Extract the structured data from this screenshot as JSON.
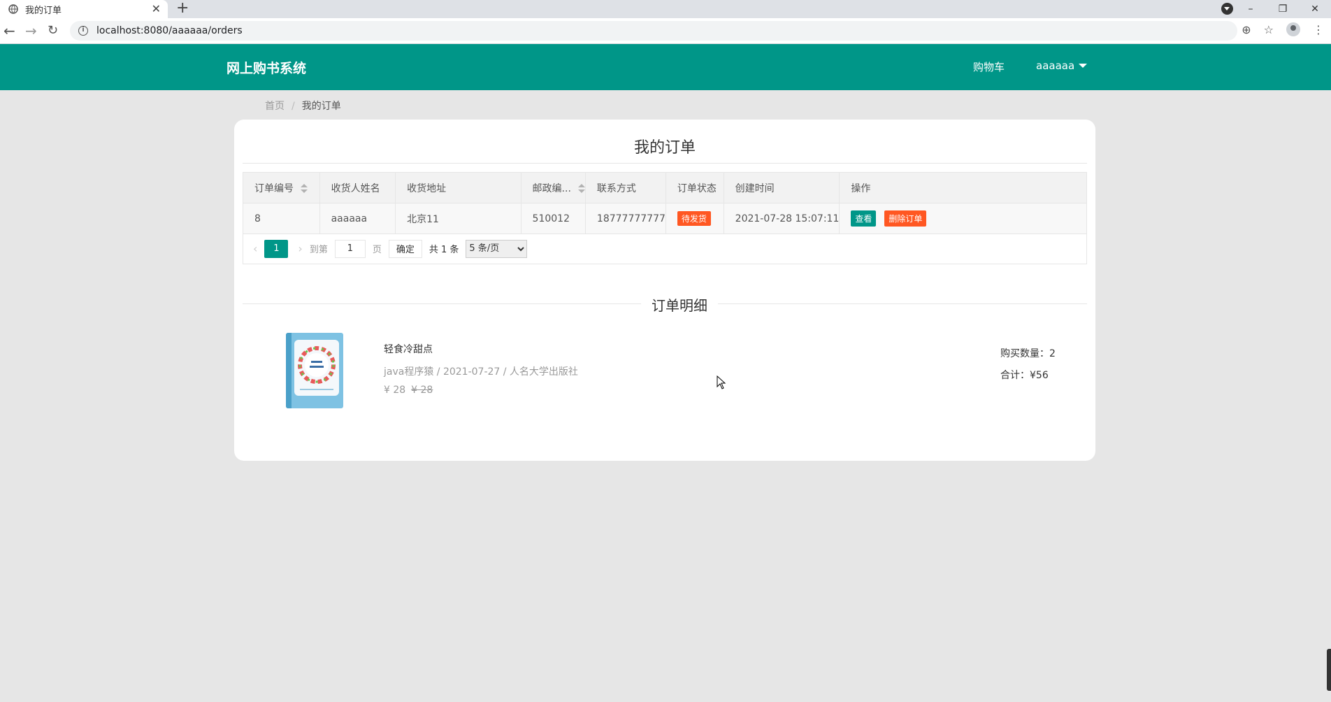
{
  "browser": {
    "tab_title": "我的订单",
    "url": "localhost:8080/aaaaaa/orders"
  },
  "header": {
    "logo": "网上购书系统",
    "cart": "购物车",
    "user": "aaaaaa"
  },
  "breadcrumb": {
    "home": "首页",
    "separator": "/",
    "current": "我的订单"
  },
  "orders": {
    "title": "我的订单",
    "columns": [
      "订单编号",
      "收货人姓名",
      "收货地址",
      "邮政编...",
      "联系方式",
      "订单状态",
      "创建时间",
      "操作"
    ],
    "rows": [
      {
        "id": "8",
        "name": "aaaaaa",
        "address": "北京11",
        "zip": "510012",
        "phone": "18777777777",
        "status": "待发货",
        "created": "2021-07-28 15:07:11",
        "view_label": "查看",
        "delete_label": "删除订单"
      }
    ]
  },
  "pager": {
    "current_page": "1",
    "goto_label": "到第",
    "page_input": "1",
    "page_unit": "页",
    "confirm": "确定",
    "total": "共 1 条",
    "page_size": "5 条/页"
  },
  "details": {
    "title": "订单明细",
    "items": [
      {
        "name": "轻食冷甜点",
        "meta": "java程序猿 / 2021-07-27 / 人名大学出版社",
        "price": "¥ 28",
        "original_price": "¥ 28",
        "qty": "购买数量：2",
        "total": "合计：¥56"
      }
    ]
  },
  "colors": {
    "brand": "#009688",
    "danger": "#ff5722"
  }
}
